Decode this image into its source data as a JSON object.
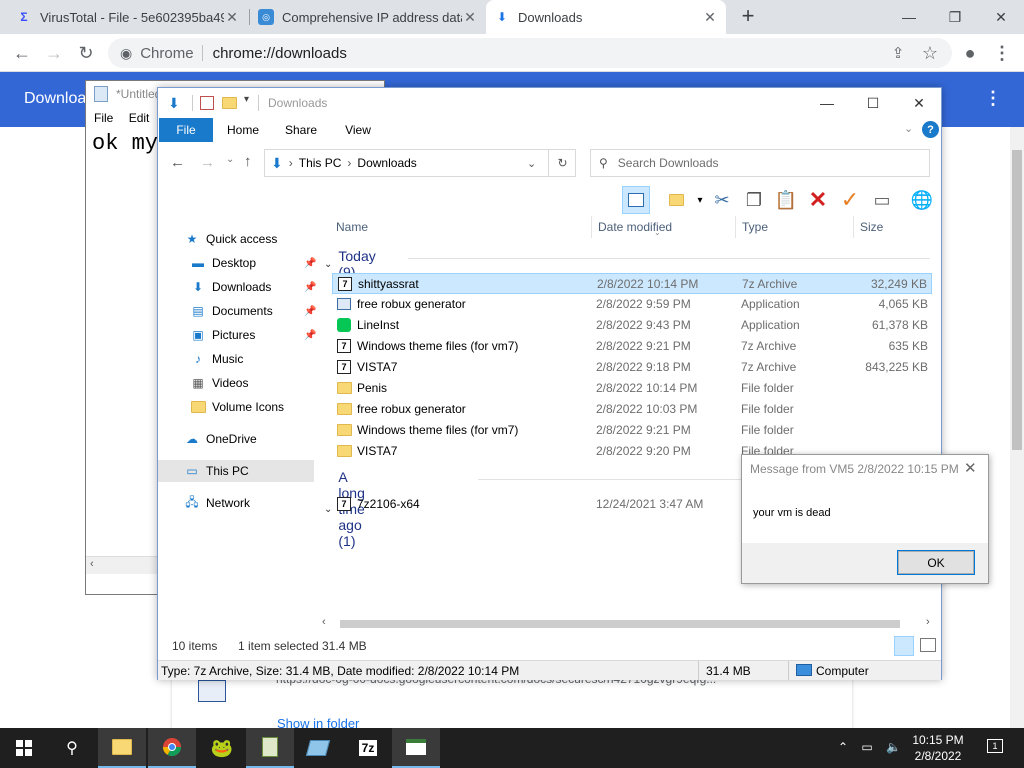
{
  "chrome": {
    "tabs": [
      {
        "title": "VirusTotal - File - 5e602395ba49",
        "icon": "virustotal-icon"
      },
      {
        "title": "Comprehensive IP address data,",
        "icon": "ipinfo-icon"
      },
      {
        "title": "Downloads",
        "icon": "download-icon"
      }
    ],
    "omnibox": {
      "chip": "Chrome",
      "url": "chrome://downloads"
    },
    "downloads_title": "Downloads",
    "download_item": {
      "url": "https://doc-0g-00-docs.googleusercontent.com/docs/securesc/h42710gzvgr9eqfg...",
      "show_in_folder": "Show in folder"
    }
  },
  "notepad": {
    "title": "*Untitled",
    "menu": [
      "File",
      "Edit"
    ],
    "text": "ok my"
  },
  "explorer": {
    "title": "Downloads",
    "ribbon_tabs": [
      "File",
      "Home",
      "Share",
      "View"
    ],
    "address": [
      "This PC",
      "Downloads"
    ],
    "search_placeholder": "Search Downloads",
    "nav": [
      {
        "label": "Quick access",
        "icon": "star-icon"
      },
      {
        "label": "Desktop",
        "icon": "desktop-icon",
        "pinned": true
      },
      {
        "label": "Downloads",
        "icon": "download-icon",
        "pinned": true
      },
      {
        "label": "Documents",
        "icon": "document-icon",
        "pinned": true
      },
      {
        "label": "Pictures",
        "icon": "picture-icon",
        "pinned": true
      },
      {
        "label": "Music",
        "icon": "music-icon"
      },
      {
        "label": "Videos",
        "icon": "video-icon"
      },
      {
        "label": "Volume Icons",
        "icon": "folder-icon"
      },
      {
        "label": "OneDrive",
        "icon": "cloud-icon"
      },
      {
        "label": "This PC",
        "icon": "computer-icon",
        "selected": true
      },
      {
        "label": "Network",
        "icon": "network-icon"
      }
    ],
    "columns": [
      "Name",
      "Date modified",
      "Type",
      "Size"
    ],
    "groups": [
      {
        "label": "Today (9)",
        "rows": [
          {
            "name": "shittyassrat",
            "date": "2/8/2022 10:14 PM",
            "type": "7z Archive",
            "size": "32,249 KB",
            "icon": "7z",
            "selected": true
          },
          {
            "name": "free robux generator",
            "date": "2/8/2022 9:59 PM",
            "type": "Application",
            "size": "4,065 KB",
            "icon": "app"
          },
          {
            "name": "LineInst",
            "date": "2/8/2022 9:43 PM",
            "type": "Application",
            "size": "61,378 KB",
            "icon": "line"
          },
          {
            "name": "Windows theme files (for vm7)",
            "date": "2/8/2022 9:21 PM",
            "type": "7z Archive",
            "size": "635 KB",
            "icon": "7z"
          },
          {
            "name": "VISTA7",
            "date": "2/8/2022 9:18 PM",
            "type": "7z Archive",
            "size": "843,225 KB",
            "icon": "7z"
          },
          {
            "name": "Penis",
            "date": "2/8/2022 10:14 PM",
            "type": "File folder",
            "size": "",
            "icon": "folder"
          },
          {
            "name": "free robux generator",
            "date": "2/8/2022 10:03 PM",
            "type": "File folder",
            "size": "",
            "icon": "folder"
          },
          {
            "name": "Windows theme files (for vm7)",
            "date": "2/8/2022 9:21 PM",
            "type": "File folder",
            "size": "",
            "icon": "folder"
          },
          {
            "name": "VISTA7",
            "date": "2/8/2022 9:20 PM",
            "type": "File folder",
            "size": "",
            "icon": "folder"
          }
        ]
      },
      {
        "label": "A long time ago (1)",
        "rows": [
          {
            "name": "7z2106-x64",
            "date": "12/24/2021 3:47 AM",
            "type": "",
            "size": "",
            "icon": "7z"
          }
        ]
      }
    ],
    "status": {
      "items": "10 items",
      "selected": "1 item selected",
      "sel_size": "31.4 MB"
    },
    "details_bar": {
      "info": "Type: 7z Archive, Size: 31.4 MB, Date modified: 2/8/2022 10:14 PM",
      "size": "31.4 MB",
      "location": "Computer"
    }
  },
  "message_box": {
    "title": "Message from VM5 2/8/2022 10:15 PM",
    "text": "your vm is dead",
    "ok": "OK"
  },
  "taskbar": {
    "time": "10:15 PM",
    "date": "2/8/2022",
    "notifications": "1"
  }
}
